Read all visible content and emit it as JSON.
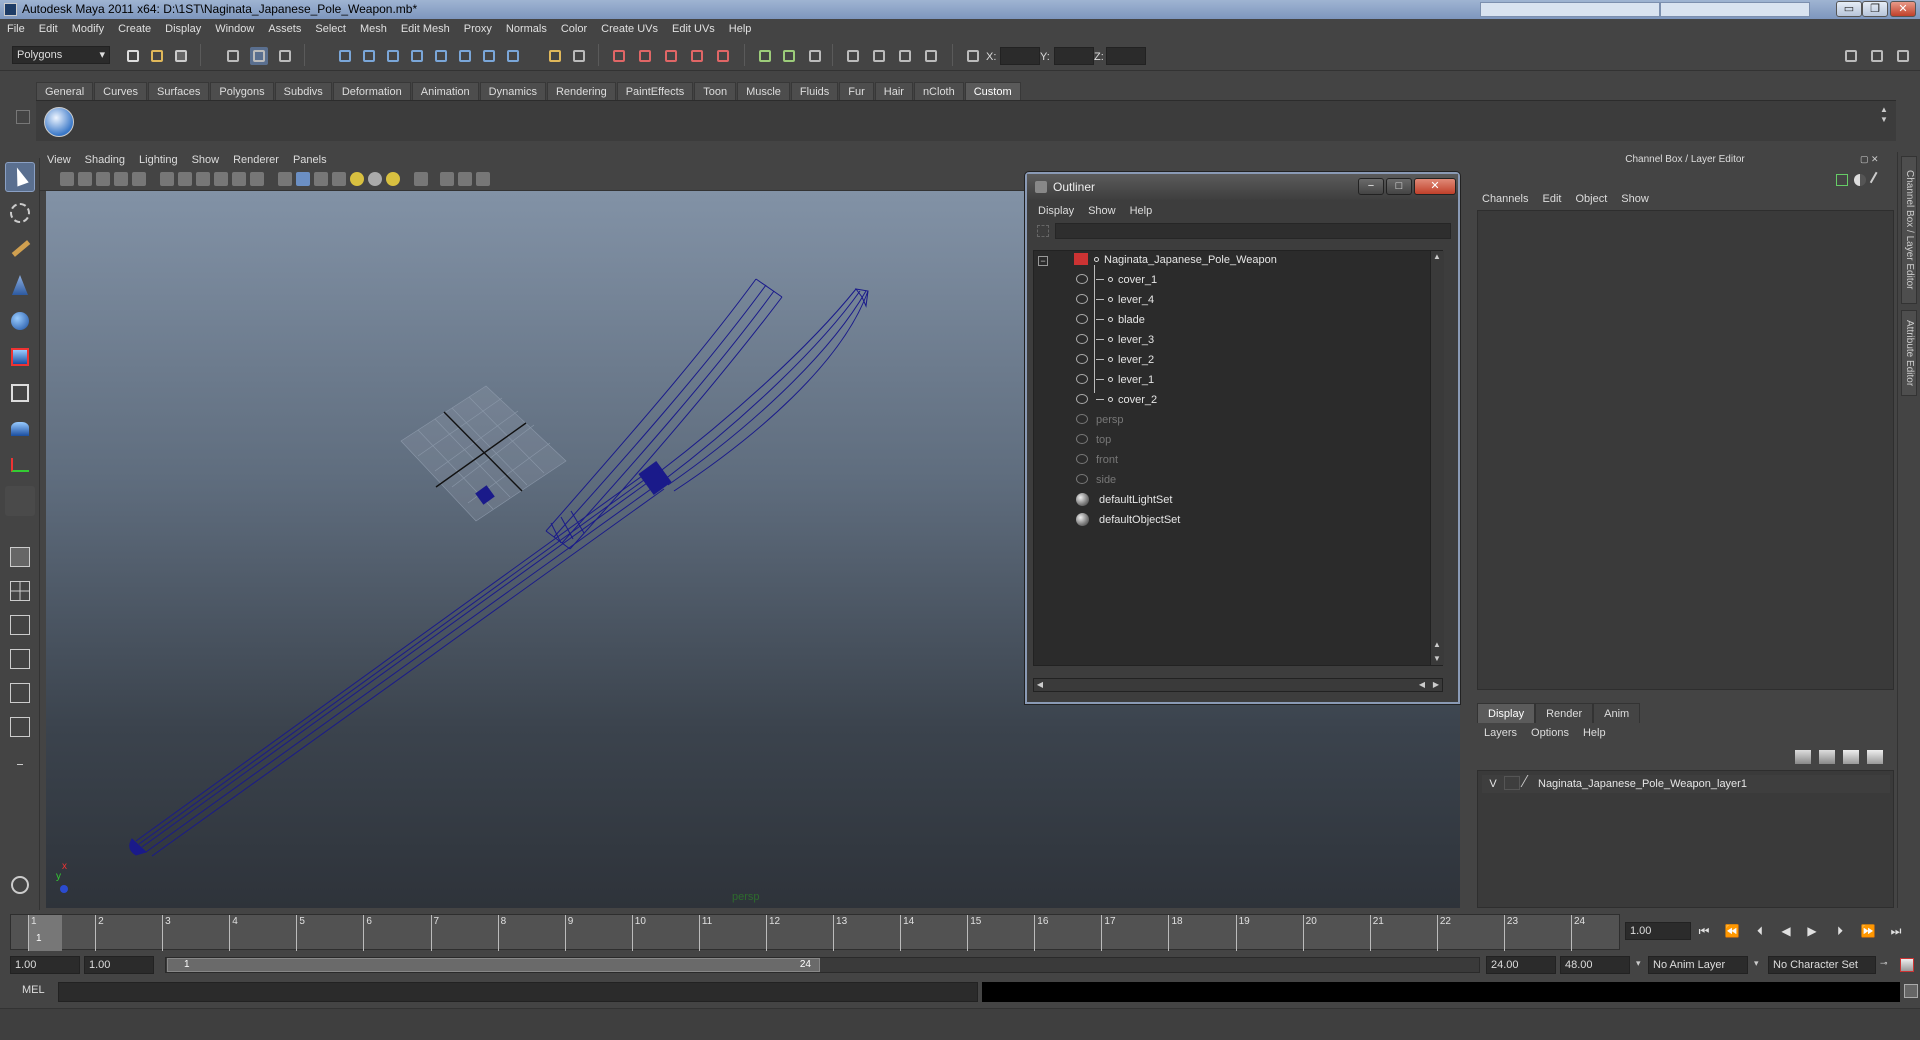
{
  "window": {
    "title": "Autodesk Maya 2011 x64: D:\\1ST\\Naginata_Japanese_Pole_Weapon.mb*",
    "minimize_label": "▭",
    "maximize_label": "❐",
    "close_label": "✕"
  },
  "menubar": [
    "File",
    "Edit",
    "Modify",
    "Create",
    "Display",
    "Window",
    "Assets",
    "Select",
    "Mesh",
    "Edit Mesh",
    "Proxy",
    "Normals",
    "Color",
    "Create UVs",
    "Edit UVs",
    "Help"
  ],
  "statusline": {
    "mode": "Polygons",
    "x_label": "X:",
    "y_label": "Y:",
    "z_label": "Z:"
  },
  "shelf_tabs": [
    "General",
    "Curves",
    "Surfaces",
    "Polygons",
    "Subdivs",
    "Deformation",
    "Animation",
    "Dynamics",
    "Rendering",
    "PaintEffects",
    "Toon",
    "Muscle",
    "Fluids",
    "Fur",
    "Hair",
    "nCloth",
    "Custom"
  ],
  "shelf_active": "Custom",
  "viewport": {
    "menu": [
      "View",
      "Shading",
      "Lighting",
      "Show",
      "Renderer",
      "Panels"
    ],
    "camera_label": "persp",
    "axis_x": "x",
    "axis_y": "y"
  },
  "outliner": {
    "title": "Outliner",
    "menu": [
      "Display",
      "Show",
      "Help"
    ],
    "root": "Naginata_Japanese_Pole_Weapon",
    "children": [
      "cover_1",
      "lever_4",
      "blade",
      "lever_3",
      "lever_2",
      "lever_1",
      "cover_2"
    ],
    "cameras": [
      "persp",
      "top",
      "front",
      "side"
    ],
    "sets": [
      "defaultLightSet",
      "defaultObjectSet"
    ]
  },
  "channel_box": {
    "title": "Channel Box / Layer Editor",
    "menu": [
      "Channels",
      "Edit",
      "Object",
      "Show"
    ]
  },
  "layer_editor": {
    "tabs": [
      "Display",
      "Render",
      "Anim"
    ],
    "active_tab": "Display",
    "menu": [
      "Layers",
      "Options",
      "Help"
    ],
    "layer_visible": "V",
    "layer_name": "Naginata_Japanese_Pole_Weapon_layer1"
  },
  "side_tabs": [
    "Channel Box / Layer Editor",
    "Attribute Editor"
  ],
  "timeline": {
    "start": 1,
    "end": 24,
    "current": 1,
    "current_label": "1",
    "current_field": "1.00",
    "labels": [
      "1",
      "2",
      "3",
      "4",
      "5",
      "6",
      "7",
      "8",
      "9",
      "10",
      "11",
      "12",
      "13",
      "14",
      "15",
      "16",
      "17",
      "18",
      "19",
      "20",
      "21",
      "22",
      "23",
      "24"
    ]
  },
  "range": {
    "start_field": "1.00",
    "playback_start_field": "1.00",
    "handle_start": "1",
    "handle_end": "24",
    "playback_end_field": "24.00",
    "end_field": "48.00",
    "anim_layer": "No Anim Layer",
    "character_set": "No Character Set"
  },
  "command_line": {
    "label": "MEL"
  }
}
